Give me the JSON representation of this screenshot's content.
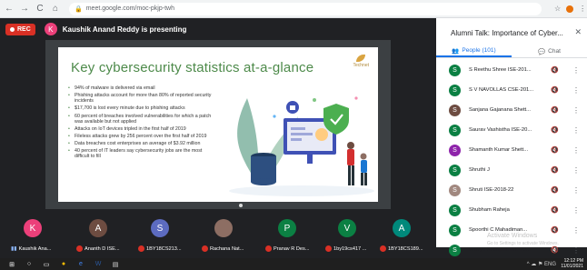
{
  "browser": {
    "back": "←",
    "forward": "→",
    "reload": "C",
    "home": "⌂",
    "url": "meet.google.com/moc-pkjp-twh",
    "tools": [
      "☆",
      "⋮"
    ]
  },
  "meeting": {
    "rec_label": "REC",
    "presenter_initial": "K",
    "presenter_text": "Kaushik Anand Reddy is presenting"
  },
  "slide": {
    "title": "Key cybersecurity statistics at-a-glance",
    "logo_text": "Technet",
    "bullets": [
      "94% of malware is delivered via email",
      "Phishing attacks account for more than 80% of reported security incidents",
      "$17,700 is lost every minute due to phishing attacks",
      "60 percent of breaches involved vulnerabilities for which a patch was available but not applied",
      "Attacks on IoT devices tripled in the first half of 2019",
      "Fileless attacks grew by 256 percent over the first half of 2019",
      "Data breaches cost enterprises an average of $3.92 million",
      "40 percent of IT leaders say cybersecurity jobs are the most difficult to fill"
    ]
  },
  "panel": {
    "title": "Alumni Talk: Importance of Cyber...",
    "close": "✕",
    "tab_people": "People (101)",
    "tab_chat": "Chat",
    "participants": [
      {
        "initial": "S",
        "name": "S Reethu Shree ISE-201...",
        "color": "#0b8043"
      },
      {
        "initial": "S",
        "name": "S V NAVOLLAS CSE-201...",
        "color": "#0b8043"
      },
      {
        "initial": "S",
        "name": "Sanjana Gajanana Shett...",
        "color": "#6d4c41"
      },
      {
        "initial": "S",
        "name": "Saurav Vashistha ISE-20...",
        "color": "#0b8043"
      },
      {
        "initial": "S",
        "name": "Shamanth Kumar Shett...",
        "color": "#8e24aa"
      },
      {
        "initial": "S",
        "name": "Shruthi J",
        "color": "#0b8043"
      },
      {
        "initial": "S",
        "name": "Shruti ISE-2018-22",
        "color": "#a1887f"
      },
      {
        "initial": "S",
        "name": "Shubham Raheja",
        "color": "#0b8043"
      },
      {
        "initial": "S",
        "name": "Spoorthi C Mahadiman...",
        "color": "#0b8043"
      },
      {
        "initial": "S",
        "name": "Sravya Kottapalli ISE-20...",
        "color": "#0b8043"
      }
    ],
    "watermark_line1": "Activate Windows",
    "watermark_line2": "Go to Settings to activate Windows."
  },
  "strip": {
    "tiles": [
      {
        "initial": "K",
        "label": "Kaushik Ana...",
        "color": "#ec407a"
      },
      {
        "initial": "A",
        "label": "Ananth D ISE...",
        "color": "#6d4c41"
      },
      {
        "initial": "S",
        "label": "1BY18CS213...",
        "color": "#5c6bc0"
      },
      {
        "initial": "R",
        "label": "Rachana Nat...",
        "color": "#8d6e63"
      },
      {
        "initial": "P",
        "label": "Pranav R Des...",
        "color": "#0b8043"
      },
      {
        "initial": "V",
        "label": "1by19cs417 ...",
        "color": "#0b8043"
      },
      {
        "initial": "A",
        "label": "1BY18CS189...",
        "color": "#00897b"
      }
    ]
  },
  "taskbar": {
    "time": "12:12 PM",
    "date": "11/01/2021",
    "tray": "^ ☁ ⚑ ENG"
  }
}
